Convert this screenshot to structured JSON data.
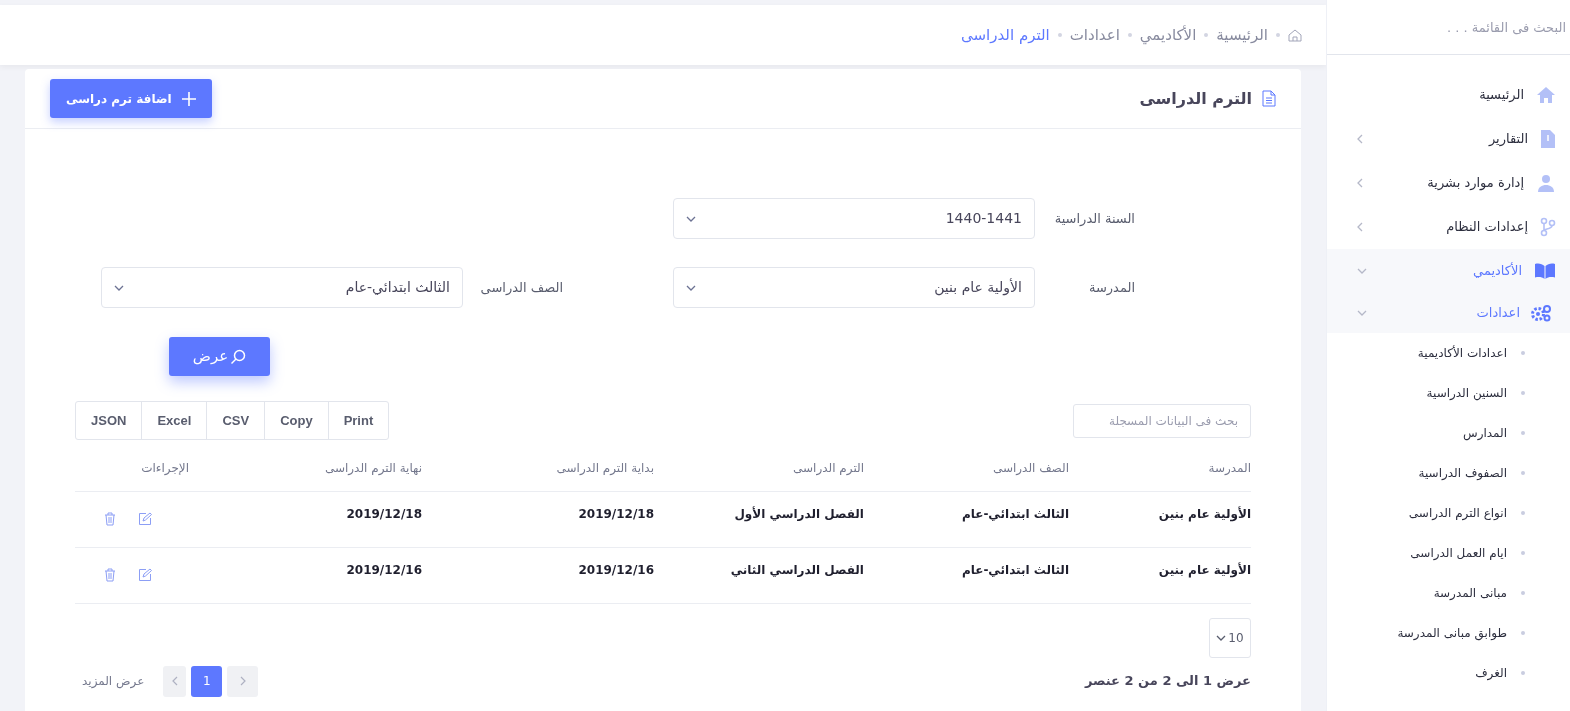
{
  "breadcrumb": [
    {
      "label": "الرئيسية",
      "selected": false
    },
    {
      "label": "الأكاديمي",
      "selected": false
    },
    {
      "label": "اعدادات",
      "selected": false
    },
    {
      "label": "الترم الدراسى",
      "selected": true
    }
  ],
  "sidebar": {
    "search": {
      "placeholder": "البحث فى القائمة . . ."
    },
    "items": [
      {
        "label": "الرئيسية"
      },
      {
        "label": "التقارير",
        "expanded": false
      },
      {
        "label": "إدارة موارد بشرية",
        "expanded": false
      },
      {
        "label": "إعدادات النظام",
        "expanded": false
      },
      {
        "label": "الأكاديمي",
        "expanded": true,
        "children": [
          {
            "label": "اعدادات",
            "expanded": true,
            "children": [
              {
                "label": "اعدادات الأكاديمية"
              },
              {
                "label": "السنين الدراسية"
              },
              {
                "label": "المدارس"
              },
              {
                "label": "الصفوف الدراسية"
              },
              {
                "label": "انواع الترم الدراسى"
              },
              {
                "label": "ايام العمل الدراسى"
              },
              {
                "label": "مبانى المدرسة"
              },
              {
                "label": "طوابق مبانى المدرسة"
              },
              {
                "label": "الغرف"
              }
            ]
          }
        ]
      }
    ]
  },
  "card": {
    "title": "الترم الدراسى",
    "add_button": "اضافة ترم دراسى"
  },
  "filters": {
    "rows": [
      [
        {
          "label": "السنة الدراسية",
          "value": "1440-1441"
        }
      ],
      [
        {
          "label": "المدرسة",
          "value": "الأولية عام بنين"
        },
        {
          "label": "الصف الدراسى",
          "value": "الثالث ابتدائي-عام"
        }
      ]
    ],
    "submit": "عرض"
  },
  "table": {
    "search": {
      "placeholder": "بحث فى البيانات المسجلة"
    },
    "export_buttons": [
      "Print",
      "Copy",
      "CSV",
      "Excel",
      "JSON"
    ],
    "columns": [
      "المدرسة",
      "الصف الدراسى",
      "الترم الدراسى",
      "بداية الترم الدراسى",
      "نهاية الترم الدراسى",
      "الإجراءات"
    ],
    "rows": [
      [
        "الأولية عام بنين",
        "الثالث ابتدائي-عام",
        "الفصل الدراسي الأول",
        "2019/12/18",
        "2019/12/18"
      ],
      [
        "الأولية عام بنين",
        "الثالث ابتدائي-عام",
        "الفصل الدراسي الثاني",
        "2019/12/16",
        "2019/12/16"
      ]
    ],
    "page_size": "10",
    "info": "عرض 1 الى 2 من 2 عنصر",
    "pages": [
      {
        "label": "1",
        "selected": true
      }
    ],
    "more": "عرض المزيد"
  }
}
